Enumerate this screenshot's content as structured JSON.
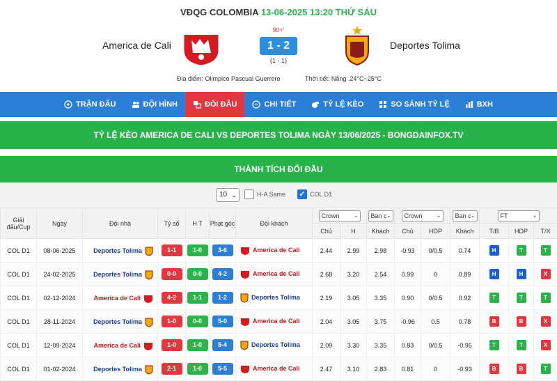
{
  "header": {
    "league": "VĐQG COLOMBIA",
    "datetime": "13-06-2025 13:20 THỨ SÁU",
    "home": "America de Cali",
    "away": "Deportes Tolima",
    "minute": "90+'",
    "score": "1 - 2",
    "halftime": "(1 - 1)",
    "venue": "Địa điểm: Olimpico Pascual Guerrero",
    "weather": "Thời tiết: Nắng ,24°C~25°C",
    "home_logo_text": "América"
  },
  "nav": [
    {
      "label": "TRẬN ĐẤU",
      "icon": "soccer-ball-icon"
    },
    {
      "label": "ĐỘI HÌNH",
      "icon": "team-icon"
    },
    {
      "label": "ĐỐI ĐẦU",
      "icon": "versus-icon",
      "active": true
    },
    {
      "label": "CHI TIẾT",
      "icon": "chat-icon"
    },
    {
      "label": "TỶ LỆ KÈO",
      "icon": "whistle-icon"
    },
    {
      "label": "SO SÁNH TỶ LỆ",
      "icon": "grid-icon"
    },
    {
      "label": "BXH",
      "icon": "bar-chart-icon"
    }
  ],
  "banner": "TỶ LỆ KÈO AMERICA DE CALI VS DEPORTES TOLIMA NGÀY 13/06/2025 - BONGDAINFOX.TV",
  "section_title": "THÀNH TÍCH ĐỐI ĐẦU",
  "filters": {
    "count": "10",
    "ha_same": "H-A Same",
    "col": "COL D1"
  },
  "columns": {
    "league": "Giải đấu/Cup",
    "date": "Ngày",
    "home": "Đội nhà",
    "score": "Tỷ số",
    "ht": "H T",
    "corner": "Phạt góc",
    "away": "Đội khách",
    "crown": "Crown",
    "banc": "Ban c",
    "ft": "FT",
    "chu": "Chủ",
    "h": "H",
    "khach": "Khách",
    "hdp": "HDP",
    "tb": "T/B",
    "tx": "T/X"
  },
  "rows": [
    {
      "league": "COL D1",
      "date": "08-06-2025",
      "home": "Deportes Tolima",
      "home_color": "blue",
      "score": "1-1",
      "score_c": "red",
      "ht": "1-0",
      "ht_c": "green",
      "corner": "3-6",
      "corner_c": "blue",
      "away": "America de Cali",
      "away_color": "red",
      "o1": "2.44",
      "o2": "2.99",
      "o3": "2.98",
      "a1": "-0.93",
      "a2": "0/0.5",
      "a3": "0.74",
      "r1": "H",
      "r2": "T",
      "r3": "T"
    },
    {
      "league": "COL D1",
      "date": "24-02-2025",
      "home": "Deportes Tolima",
      "home_color": "blue",
      "score": "0-0",
      "score_c": "red",
      "ht": "0-0",
      "ht_c": "green",
      "corner": "4-2",
      "corner_c": "blue",
      "away": "America de Cali",
      "away_color": "red",
      "o1": "2.68",
      "o2": "3.20",
      "o3": "2.54",
      "a1": "0.99",
      "a2": "0",
      "a3": "0.89",
      "r1": "H",
      "r2": "H",
      "r3": "X"
    },
    {
      "league": "COL D1",
      "date": "02-12-2024",
      "home": "America de Cali",
      "home_color": "red",
      "score": "4-2",
      "score_c": "red",
      "ht": "1-1",
      "ht_c": "green",
      "corner": "1-2",
      "corner_c": "blue",
      "away": "Deportes Tolima",
      "away_color": "blue",
      "o1": "2.19",
      "o2": "3.05",
      "o3": "3.35",
      "a1": "0.90",
      "a2": "0/0.5",
      "a3": "0.92",
      "r1": "T",
      "r2": "T",
      "r3": "T"
    },
    {
      "league": "COL D1",
      "date": "28-11-2024",
      "home": "Deportes Tolima",
      "home_color": "blue",
      "score": "1-0",
      "score_c": "red",
      "ht": "0-0",
      "ht_c": "green",
      "corner": "5-0",
      "corner_c": "blue",
      "away": "America de Cali",
      "away_color": "red",
      "o1": "2.04",
      "o2": "3.05",
      "o3": "3.75",
      "a1": "-0.96",
      "a2": "0.5",
      "a3": "0.78",
      "r1": "B",
      "r2": "B",
      "r3": "X"
    },
    {
      "league": "COL D1",
      "date": "12-09-2024",
      "home": "America de Cali",
      "home_color": "red",
      "score": "1-0",
      "score_c": "red",
      "ht": "1-0",
      "ht_c": "green",
      "corner": "5-4",
      "corner_c": "blue",
      "away": "Deportes Tolima",
      "away_color": "blue",
      "o1": "2.09",
      "o2": "3.30",
      "o3": "3.35",
      "a1": "0.83",
      "a2": "0/0.5",
      "a3": "-0.95",
      "r1": "T",
      "r2": "T",
      "r3": "X"
    },
    {
      "league": "COL D1",
      "date": "01-02-2024",
      "home": "Deportes Tolima",
      "home_color": "blue",
      "score": "2-1",
      "score_c": "red",
      "ht": "1-0",
      "ht_c": "green",
      "corner": "5-5",
      "corner_c": "blue",
      "away": "America de Cali",
      "away_color": "red",
      "o1": "2.47",
      "o2": "3.10",
      "o3": "2.83",
      "a1": "0.81",
      "a2": "0",
      "a3": "-0.93",
      "r1": "B",
      "r2": "B",
      "r3": "T"
    }
  ],
  "colors": {
    "nav": "#2b7fd6",
    "active": "#e2373f",
    "green": "#27b24a"
  }
}
